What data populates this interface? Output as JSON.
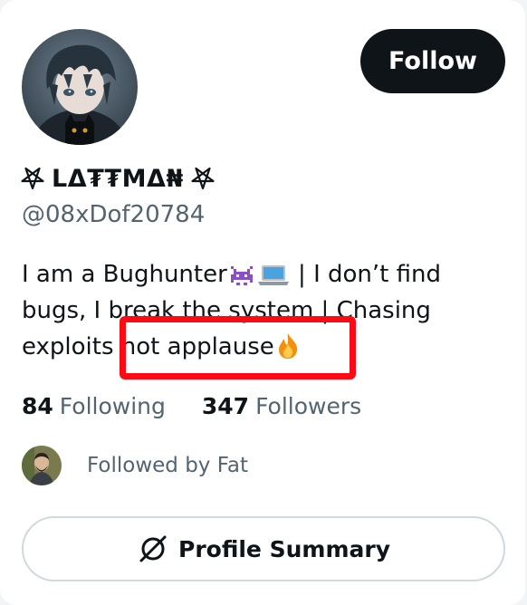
{
  "profile": {
    "display_name": "LΔ₮₮MΔ₦",
    "handle": "@08xDof20784",
    "avatar_icon": "anime-boy-avatar",
    "follow_label": "Follow"
  },
  "bio": {
    "line1_prefix": "I am a Bughunter",
    "line1_suffix": " | I don’t find",
    "line2": "bugs, I break the system | Chasing",
    "line3_prefix": "exploits ",
    "line3_highlight": "not applause",
    "emojis": [
      "alien-monster-emoji",
      "laptop-emoji",
      "fire-emoji"
    ]
  },
  "stats": {
    "following_count": "84",
    "following_label": "Following",
    "followers_count": "347",
    "followers_label": "Followers"
  },
  "followed_by": {
    "text": "Followed by Fat",
    "avatar_icon": "follower-avatar"
  },
  "summary": {
    "label": "Profile Summary",
    "icon": "grok-icon"
  },
  "colors": {
    "primary_text": "#0f1419",
    "secondary_text": "#536471",
    "button_bg": "#0f1419",
    "highlight": "#ff0a14",
    "border": "#cfd9de"
  }
}
